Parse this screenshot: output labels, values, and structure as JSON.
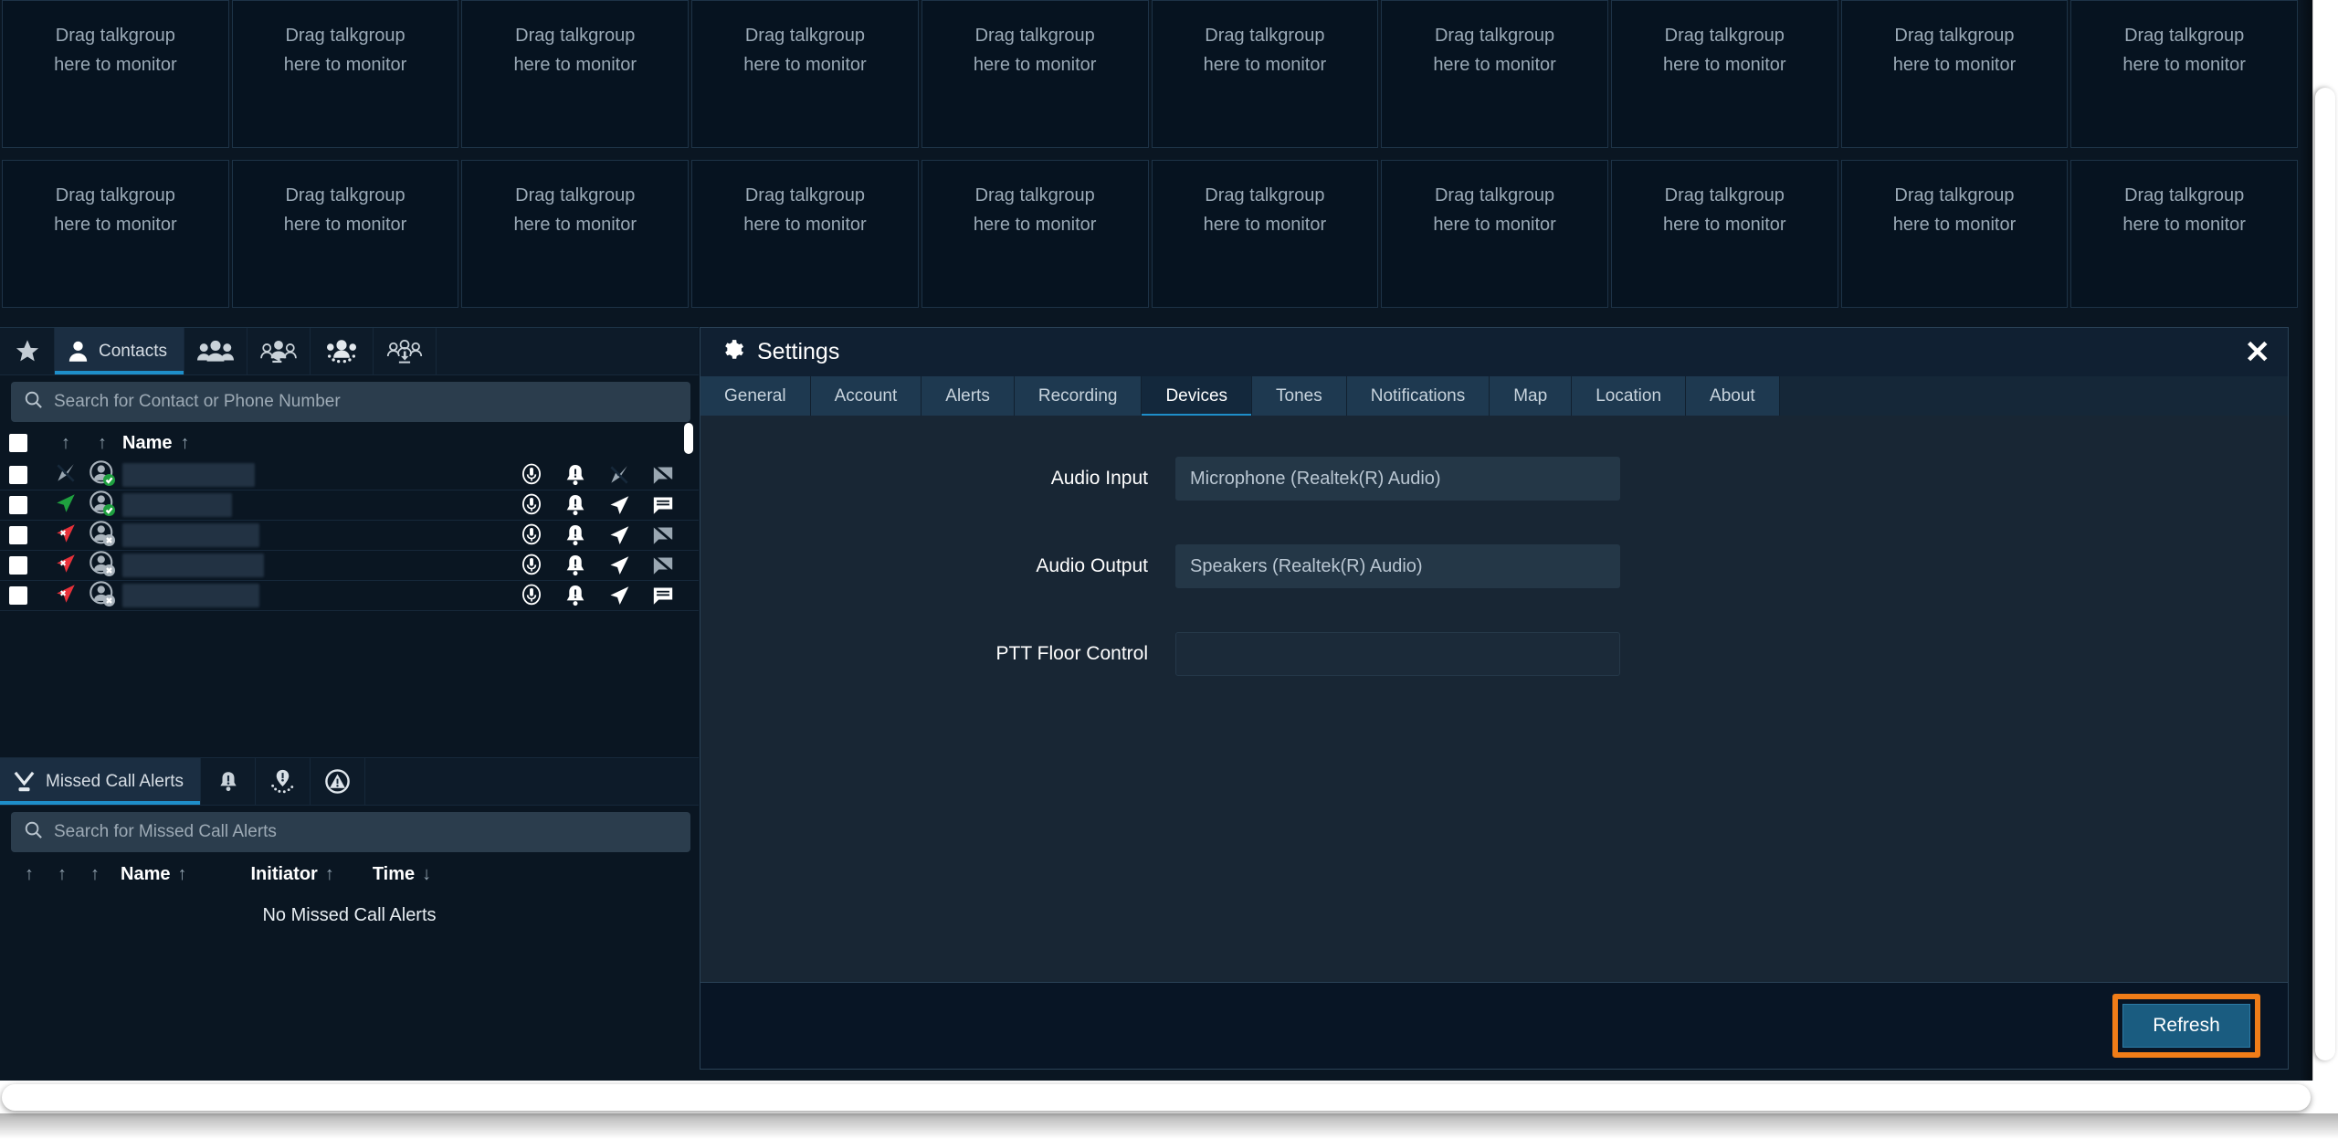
{
  "talkgroups": {
    "placeholder_line1": "Drag talkgroup",
    "placeholder_line2": "here to monitor",
    "columns": 10,
    "rows": 2
  },
  "contacts_panel": {
    "tabs": [
      {
        "label": "",
        "icon": "star-icon",
        "active": false
      },
      {
        "label": "Contacts",
        "icon": "person-icon",
        "active": true
      },
      {
        "label": "",
        "icon": "groups-icon",
        "active": false
      },
      {
        "label": "",
        "icon": "broadcast-group-icon",
        "active": false
      },
      {
        "label": "",
        "icon": "dynamic-group-icon",
        "active": false
      },
      {
        "label": "",
        "icon": "import-group-icon",
        "active": false
      }
    ],
    "search": {
      "placeholder": "Search for Contact or Phone Number",
      "value": ""
    },
    "columns": {
      "name": "Name",
      "sort_asc": "↑",
      "sort_desc": "↓"
    },
    "rows": [
      {
        "presence": "no-location-icon",
        "avatar": "avatar-available-icon",
        "name": "",
        "actions": [
          "mic-icon",
          "alert-icon",
          "no-location-icon",
          "message-disabled-icon"
        ]
      },
      {
        "presence": "location-green-icon",
        "avatar": "avatar-available-icon",
        "name": "",
        "actions": [
          "mic-icon",
          "alert-icon",
          "location-icon",
          "message-icon"
        ]
      },
      {
        "presence": "location-red-x-icon",
        "avatar": "avatar-offline-icon",
        "name": "",
        "actions": [
          "mic-icon",
          "alert-icon",
          "location-icon",
          "message-disabled-icon"
        ]
      },
      {
        "presence": "location-red-x-icon",
        "avatar": "avatar-offline-icon",
        "name": "",
        "actions": [
          "mic-icon",
          "alert-icon",
          "location-icon",
          "message-disabled-icon"
        ]
      },
      {
        "presence": "location-red-x-icon",
        "avatar": "avatar-offline-icon",
        "name": "",
        "actions": [
          "mic-icon",
          "alert-icon",
          "location-icon",
          "message-icon"
        ]
      }
    ]
  },
  "alerts_panel": {
    "tabs": [
      {
        "label": "Missed Call Alerts",
        "icon": "missed-call-icon",
        "active": true
      },
      {
        "label": "",
        "icon": "alert-bell-icon",
        "active": false
      },
      {
        "label": "",
        "icon": "geofence-alert-icon",
        "active": false
      },
      {
        "label": "",
        "icon": "emergency-alert-icon",
        "active": false
      }
    ],
    "search": {
      "placeholder": "Search for Missed Call Alerts",
      "value": ""
    },
    "columns": {
      "name": "Name",
      "initiator": "Initiator",
      "time": "Time",
      "sort_asc": "↑",
      "sort_desc": "↓"
    },
    "empty_message": "No Missed Call Alerts"
  },
  "settings": {
    "title": "Settings",
    "title_icon": "gear-icon",
    "close_icon": "close-icon",
    "close_label": "✕",
    "tabs": [
      {
        "label": "General",
        "active": false
      },
      {
        "label": "Account",
        "active": false
      },
      {
        "label": "Alerts",
        "active": false
      },
      {
        "label": "Recording",
        "active": false
      },
      {
        "label": "Devices",
        "active": true
      },
      {
        "label": "Tones",
        "active": false
      },
      {
        "label": "Notifications",
        "active": false
      },
      {
        "label": "Map",
        "active": false
      },
      {
        "label": "Location",
        "active": false
      },
      {
        "label": "About",
        "active": false
      }
    ],
    "fields": [
      {
        "label": "Audio Input",
        "value": "Microphone (Realtek(R) Audio)",
        "empty": false
      },
      {
        "label": "Audio Output",
        "value": "Speakers (Realtek(R) Audio)",
        "empty": false
      },
      {
        "label": "PTT Floor Control",
        "value": "",
        "empty": true
      }
    ],
    "footer": {
      "refresh_label": "Refresh",
      "highlight_color": "#f07d18"
    }
  },
  "colors": {
    "app_background": "#0a1622",
    "panel_background": "#0d1b29",
    "dialog_background": "#182634",
    "accent_blue": "#1e8ec9",
    "highlight_orange": "#f07d18",
    "button_blue": "#1a5c80",
    "status_green": "#1fa03f",
    "status_red": "#e8313a"
  }
}
